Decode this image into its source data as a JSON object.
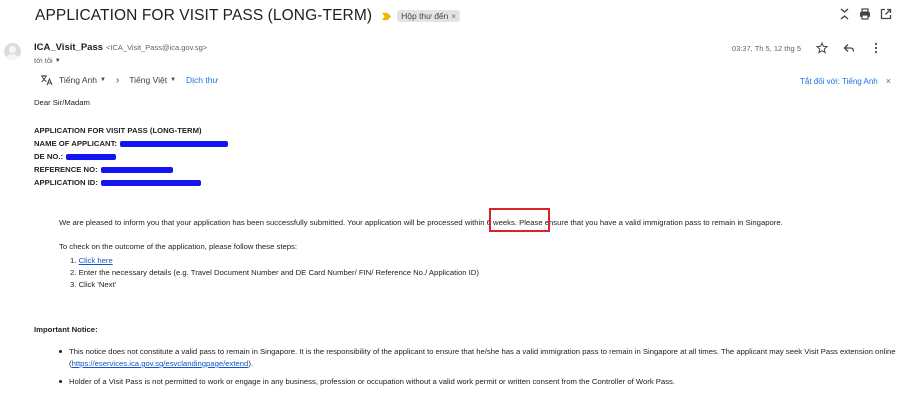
{
  "email": {
    "subject": "APPLICATION FOR VISIT PASS (LONG-TERM)",
    "label": "Hộp thư đến",
    "label_close": "×",
    "sender_name": "ICA_Visit_Pass",
    "sender_email": "<ICA_Visit_Pass@ica.gov.sg>",
    "to": "tới tôi",
    "date": "03:37, Th 5, 12 thg 5"
  },
  "translate": {
    "from_lang": "Tiếng Anh",
    "to_lang": "Tiếng Việt",
    "translate_link": "Dịch thư",
    "turn_off": "Tắt đối với: Tiếng Anh",
    "close": "×"
  },
  "body": {
    "greeting": "Dear Sir/Madam",
    "info": [
      {
        "label": "APPLICATION FOR VISIT PASS (LONG-TERM)",
        "value": ""
      },
      {
        "label": "NAME OF APPLICANT:",
        "value": "[redacted]"
      },
      {
        "label": "DE NO.:",
        "value": "[redacted]"
      },
      {
        "label": "REFERENCE NO:",
        "value": "[redacted]"
      },
      {
        "label": "APPLICATION ID:",
        "value": "[redacted]"
      }
    ],
    "para1_before": "We are pleased to inform you that your application has been successfully submitted. Your application will be processed ",
    "para1_highlight": "within 6 weeks",
    "para1_after": ". Please ensure that you have a valid immigration pass to remain in Singapore.",
    "para2": "To check on the outcome of the application, please follow these steps:",
    "steps": [
      {
        "num": "1.",
        "text": "Click here",
        "is_link": true
      },
      {
        "num": "2.",
        "text": "Enter the necessary details (e.g. Travel Document Number and DE Card Number/ FIN/ Reference No./ Application ID)",
        "is_link": false
      },
      {
        "num": "3.",
        "text": "Click 'Next'",
        "is_link": false
      }
    ],
    "notice_title": "Important Notice:",
    "notice1_before": "This notice does not constitute a valid pass to remain in Singapore. It is the responsibility of the applicant to ensure that he/she has a valid immigration pass to remain in Singapore at all times. The applicant may seek Visit Pass extension online (",
    "notice1_link": "https://eservices.ica.gov.sg/esvclandingpage/extend",
    "notice1_after": ").",
    "notice2": "Holder of a Visit Pass is not permitted to work or engage in any business, profession or occupation without a valid work permit or written consent from the Controller of Work Pass."
  },
  "colors": {
    "link": "#1155cc",
    "translate_link": "#1a73e8",
    "highlight_border": "#d9222a",
    "redaction": "#1414f0"
  }
}
